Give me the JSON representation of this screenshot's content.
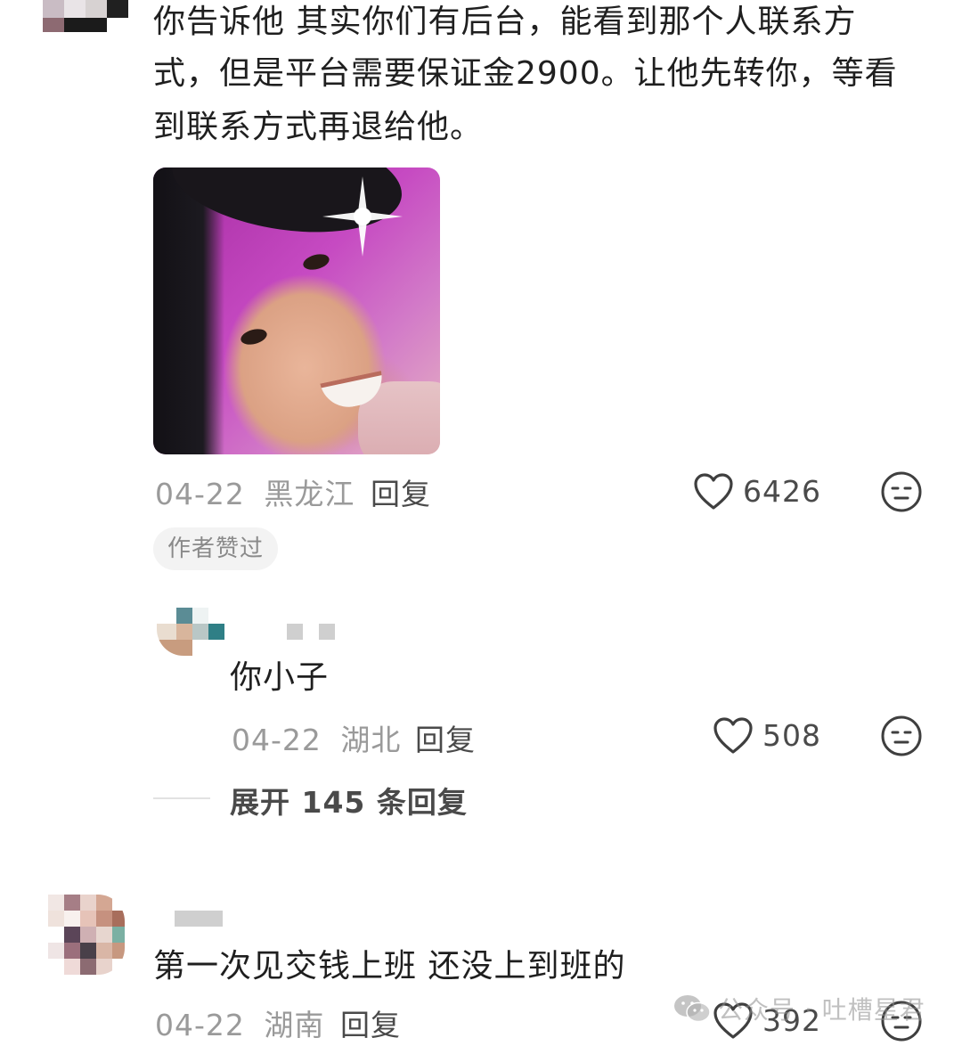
{
  "comment1": {
    "text_line1": "你告诉他 其实你们有后台，能看到那个人联系方",
    "text_line2": "式，但是平台需要保证金2900。让他先转你，等看",
    "text_line3": "到联系方式再退给他。",
    "date": "04-22",
    "location": "黑龙江",
    "reply_label": "回复",
    "likes": "6426",
    "author_liked_badge": "作者赞过"
  },
  "reply1": {
    "text": "你小子",
    "date": "04-22",
    "location": "湖北",
    "reply_label": "回复",
    "likes": "508"
  },
  "expand_replies": "展开 145 条回复",
  "comment2": {
    "text": "第一次见交钱上班 还没上到班的",
    "date": "04-22",
    "location": "湖南",
    "reply_label": "回复",
    "likes": "392"
  },
  "watermark": {
    "text": "公众号 · 吐槽星君",
    "icon": "wechat-icon"
  },
  "colors": {
    "text": "#1f1f1f",
    "meta": "#9a9a9a",
    "action": "#4a4a4a",
    "badge_bg": "#f3f3f3"
  }
}
